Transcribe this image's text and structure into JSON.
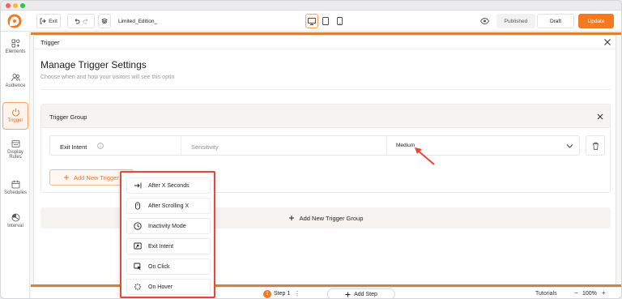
{
  "toolbar": {
    "exit_label": "Exit",
    "campaign_name": "Limited_Edition_",
    "published_label": "Published",
    "draft_label": "Draft",
    "update_label": "Update"
  },
  "sidebar": {
    "items": [
      {
        "label": "Elements",
        "icon": "elements-icon"
      },
      {
        "label": "Audience",
        "icon": "audience-icon"
      },
      {
        "label": "Trigger",
        "icon": "power-icon"
      },
      {
        "label": "Display Rules",
        "icon": "display-rules-icon"
      },
      {
        "label": "Schedules",
        "icon": "calendar-icon"
      },
      {
        "label": "Interval",
        "icon": "interval-icon"
      }
    ]
  },
  "modal": {
    "header_title": "Trigger",
    "title": "Manage Trigger Settings",
    "subtitle": "Choose when and how your visitors will see this optin"
  },
  "trigger_group": {
    "title": "Trigger Group",
    "trigger_name": "Exit Intent",
    "sensitivity_label": "Sensitivity",
    "sensitivity_value": "Medium",
    "add_trigger_label": "Add New Trigger",
    "add_group_label": "Add New Trigger Group"
  },
  "trigger_menu": {
    "items": [
      {
        "label": "After X Seconds",
        "icon": "arrow-to-line-icon"
      },
      {
        "label": "After Scrolling X",
        "icon": "mouse-scroll-icon"
      },
      {
        "label": "Inactivity Mode",
        "icon": "clock-icon"
      },
      {
        "label": "Exit Intent",
        "icon": "exit-window-icon"
      },
      {
        "label": "On Click",
        "icon": "click-cursor-icon"
      },
      {
        "label": "On Hover",
        "icon": "hover-burst-icon"
      }
    ]
  },
  "footer": {
    "step_number": "1",
    "step_label": "Step 1",
    "add_step_label": "Add Step",
    "tutorials_label": "Tutorials",
    "zoom_value": "100%"
  },
  "colors": {
    "accent": "#f47a20",
    "highlight_border": "#e5473c",
    "canvas_strip": "#d2853a"
  }
}
